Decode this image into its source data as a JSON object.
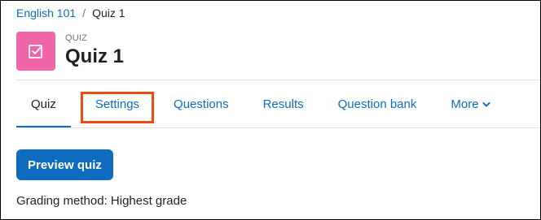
{
  "breadcrumb": {
    "course": "English 101",
    "separator": "/",
    "current": "Quiz 1"
  },
  "header": {
    "kicker": "QUIZ",
    "title": "Quiz 1",
    "icon": "quiz-checkbox-icon",
    "icon_color": "#f065a8"
  },
  "tabs": [
    {
      "label": "Quiz",
      "active": true
    },
    {
      "label": "Settings",
      "highlighted": true
    },
    {
      "label": "Questions"
    },
    {
      "label": "Results"
    },
    {
      "label": "Question bank"
    },
    {
      "label": "More"
    }
  ],
  "actions": {
    "preview_label": "Preview quiz"
  },
  "info": {
    "grading_method": "Grading method: Highest grade"
  },
  "colors": {
    "accent": "#0f6cbf",
    "highlight_box": "#f04a0d"
  }
}
